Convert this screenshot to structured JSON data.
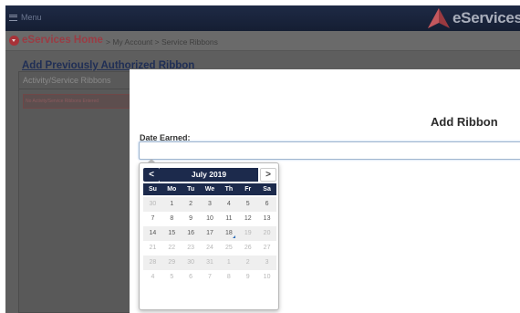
{
  "topbar": {
    "menu_label": "Menu",
    "brand": "eServices"
  },
  "breadcrumb": {
    "home": "eServices Home",
    "rest": " > My Account > Service Ribbons"
  },
  "page": {
    "title": "Add Previously Authorized Ribbon"
  },
  "left_panel": {
    "title": "Activity/Service Ribbons",
    "empty_message": "No Activity/Service Ribbons Entered"
  },
  "modal": {
    "title": "Add Ribbon",
    "date_label": "Date Earned:",
    "date_value": ""
  },
  "datepicker": {
    "prev": "<",
    "next": ">",
    "month_label": "July 2019",
    "dows": [
      "Su",
      "Mo",
      "Tu",
      "We",
      "Th",
      "Fr",
      "Sa"
    ],
    "weeks": [
      [
        {
          "d": "30",
          "m": true
        },
        {
          "d": "1"
        },
        {
          "d": "2"
        },
        {
          "d": "3"
        },
        {
          "d": "4"
        },
        {
          "d": "5"
        },
        {
          "d": "6"
        }
      ],
      [
        {
          "d": "7"
        },
        {
          "d": "8"
        },
        {
          "d": "9"
        },
        {
          "d": "10"
        },
        {
          "d": "11"
        },
        {
          "d": "12"
        },
        {
          "d": "13"
        }
      ],
      [
        {
          "d": "14"
        },
        {
          "d": "15"
        },
        {
          "d": "16"
        },
        {
          "d": "17"
        },
        {
          "d": "18",
          "today": true
        },
        {
          "d": "19",
          "m": true
        },
        {
          "d": "20",
          "m": true
        }
      ],
      [
        {
          "d": "21",
          "m": true
        },
        {
          "d": "22",
          "m": true
        },
        {
          "d": "23",
          "m": true
        },
        {
          "d": "24",
          "m": true
        },
        {
          "d": "25",
          "m": true
        },
        {
          "d": "26",
          "m": true
        },
        {
          "d": "27",
          "m": true
        }
      ],
      [
        {
          "d": "28",
          "m": true
        },
        {
          "d": "29",
          "m": true
        },
        {
          "d": "30",
          "m": true
        },
        {
          "d": "31",
          "m": true
        },
        {
          "d": "1",
          "m": true
        },
        {
          "d": "2",
          "m": true
        },
        {
          "d": "3",
          "m": true
        }
      ],
      [
        {
          "d": "4",
          "m": true
        },
        {
          "d": "5",
          "m": true
        },
        {
          "d": "6",
          "m": true
        },
        {
          "d": "7",
          "m": true
        },
        {
          "d": "8",
          "m": true
        },
        {
          "d": "9",
          "m": true
        },
        {
          "d": "10",
          "m": true
        }
      ]
    ]
  },
  "colors": {
    "navy": "#1c2a4c",
    "brand_red": "#a83238",
    "overlay": "#5e5e5e"
  }
}
